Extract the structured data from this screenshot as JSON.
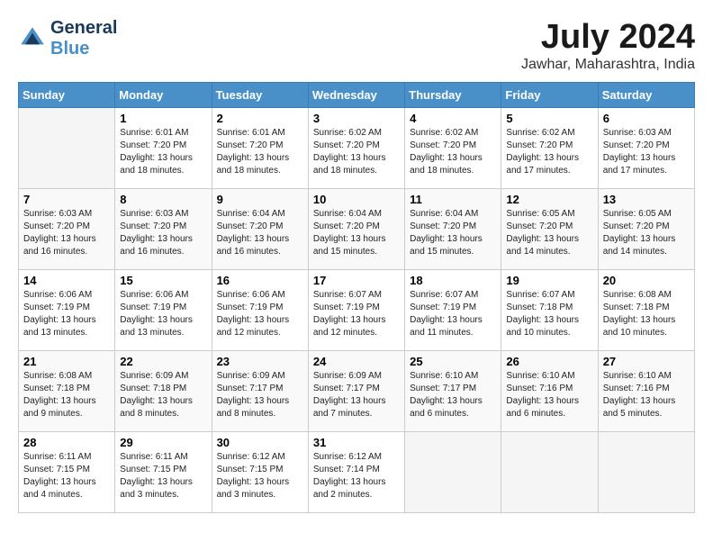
{
  "header": {
    "logo_line1": "General",
    "logo_line2": "Blue",
    "month_year": "July 2024",
    "location": "Jawhar, Maharashtra, India"
  },
  "weekdays": [
    "Sunday",
    "Monday",
    "Tuesday",
    "Wednesday",
    "Thursday",
    "Friday",
    "Saturday"
  ],
  "weeks": [
    [
      {
        "day": "",
        "info": ""
      },
      {
        "day": "1",
        "info": "Sunrise: 6:01 AM\nSunset: 7:20 PM\nDaylight: 13 hours\nand 18 minutes."
      },
      {
        "day": "2",
        "info": "Sunrise: 6:01 AM\nSunset: 7:20 PM\nDaylight: 13 hours\nand 18 minutes."
      },
      {
        "day": "3",
        "info": "Sunrise: 6:02 AM\nSunset: 7:20 PM\nDaylight: 13 hours\nand 18 minutes."
      },
      {
        "day": "4",
        "info": "Sunrise: 6:02 AM\nSunset: 7:20 PM\nDaylight: 13 hours\nand 18 minutes."
      },
      {
        "day": "5",
        "info": "Sunrise: 6:02 AM\nSunset: 7:20 PM\nDaylight: 13 hours\nand 17 minutes."
      },
      {
        "day": "6",
        "info": "Sunrise: 6:03 AM\nSunset: 7:20 PM\nDaylight: 13 hours\nand 17 minutes."
      }
    ],
    [
      {
        "day": "7",
        "info": "Sunrise: 6:03 AM\nSunset: 7:20 PM\nDaylight: 13 hours\nand 16 minutes."
      },
      {
        "day": "8",
        "info": "Sunrise: 6:03 AM\nSunset: 7:20 PM\nDaylight: 13 hours\nand 16 minutes."
      },
      {
        "day": "9",
        "info": "Sunrise: 6:04 AM\nSunset: 7:20 PM\nDaylight: 13 hours\nand 16 minutes."
      },
      {
        "day": "10",
        "info": "Sunrise: 6:04 AM\nSunset: 7:20 PM\nDaylight: 13 hours\nand 15 minutes."
      },
      {
        "day": "11",
        "info": "Sunrise: 6:04 AM\nSunset: 7:20 PM\nDaylight: 13 hours\nand 15 minutes."
      },
      {
        "day": "12",
        "info": "Sunrise: 6:05 AM\nSunset: 7:20 PM\nDaylight: 13 hours\nand 14 minutes."
      },
      {
        "day": "13",
        "info": "Sunrise: 6:05 AM\nSunset: 7:20 PM\nDaylight: 13 hours\nand 14 minutes."
      }
    ],
    [
      {
        "day": "14",
        "info": "Sunrise: 6:06 AM\nSunset: 7:19 PM\nDaylight: 13 hours\nand 13 minutes."
      },
      {
        "day": "15",
        "info": "Sunrise: 6:06 AM\nSunset: 7:19 PM\nDaylight: 13 hours\nand 13 minutes."
      },
      {
        "day": "16",
        "info": "Sunrise: 6:06 AM\nSunset: 7:19 PM\nDaylight: 13 hours\nand 12 minutes."
      },
      {
        "day": "17",
        "info": "Sunrise: 6:07 AM\nSunset: 7:19 PM\nDaylight: 13 hours\nand 12 minutes."
      },
      {
        "day": "18",
        "info": "Sunrise: 6:07 AM\nSunset: 7:19 PM\nDaylight: 13 hours\nand 11 minutes."
      },
      {
        "day": "19",
        "info": "Sunrise: 6:07 AM\nSunset: 7:18 PM\nDaylight: 13 hours\nand 10 minutes."
      },
      {
        "day": "20",
        "info": "Sunrise: 6:08 AM\nSunset: 7:18 PM\nDaylight: 13 hours\nand 10 minutes."
      }
    ],
    [
      {
        "day": "21",
        "info": "Sunrise: 6:08 AM\nSunset: 7:18 PM\nDaylight: 13 hours\nand 9 minutes."
      },
      {
        "day": "22",
        "info": "Sunrise: 6:09 AM\nSunset: 7:18 PM\nDaylight: 13 hours\nand 8 minutes."
      },
      {
        "day": "23",
        "info": "Sunrise: 6:09 AM\nSunset: 7:17 PM\nDaylight: 13 hours\nand 8 minutes."
      },
      {
        "day": "24",
        "info": "Sunrise: 6:09 AM\nSunset: 7:17 PM\nDaylight: 13 hours\nand 7 minutes."
      },
      {
        "day": "25",
        "info": "Sunrise: 6:10 AM\nSunset: 7:17 PM\nDaylight: 13 hours\nand 6 minutes."
      },
      {
        "day": "26",
        "info": "Sunrise: 6:10 AM\nSunset: 7:16 PM\nDaylight: 13 hours\nand 6 minutes."
      },
      {
        "day": "27",
        "info": "Sunrise: 6:10 AM\nSunset: 7:16 PM\nDaylight: 13 hours\nand 5 minutes."
      }
    ],
    [
      {
        "day": "28",
        "info": "Sunrise: 6:11 AM\nSunset: 7:15 PM\nDaylight: 13 hours\nand 4 minutes."
      },
      {
        "day": "29",
        "info": "Sunrise: 6:11 AM\nSunset: 7:15 PM\nDaylight: 13 hours\nand 3 minutes."
      },
      {
        "day": "30",
        "info": "Sunrise: 6:12 AM\nSunset: 7:15 PM\nDaylight: 13 hours\nand 3 minutes."
      },
      {
        "day": "31",
        "info": "Sunrise: 6:12 AM\nSunset: 7:14 PM\nDaylight: 13 hours\nand 2 minutes."
      },
      {
        "day": "",
        "info": ""
      },
      {
        "day": "",
        "info": ""
      },
      {
        "day": "",
        "info": ""
      }
    ]
  ]
}
